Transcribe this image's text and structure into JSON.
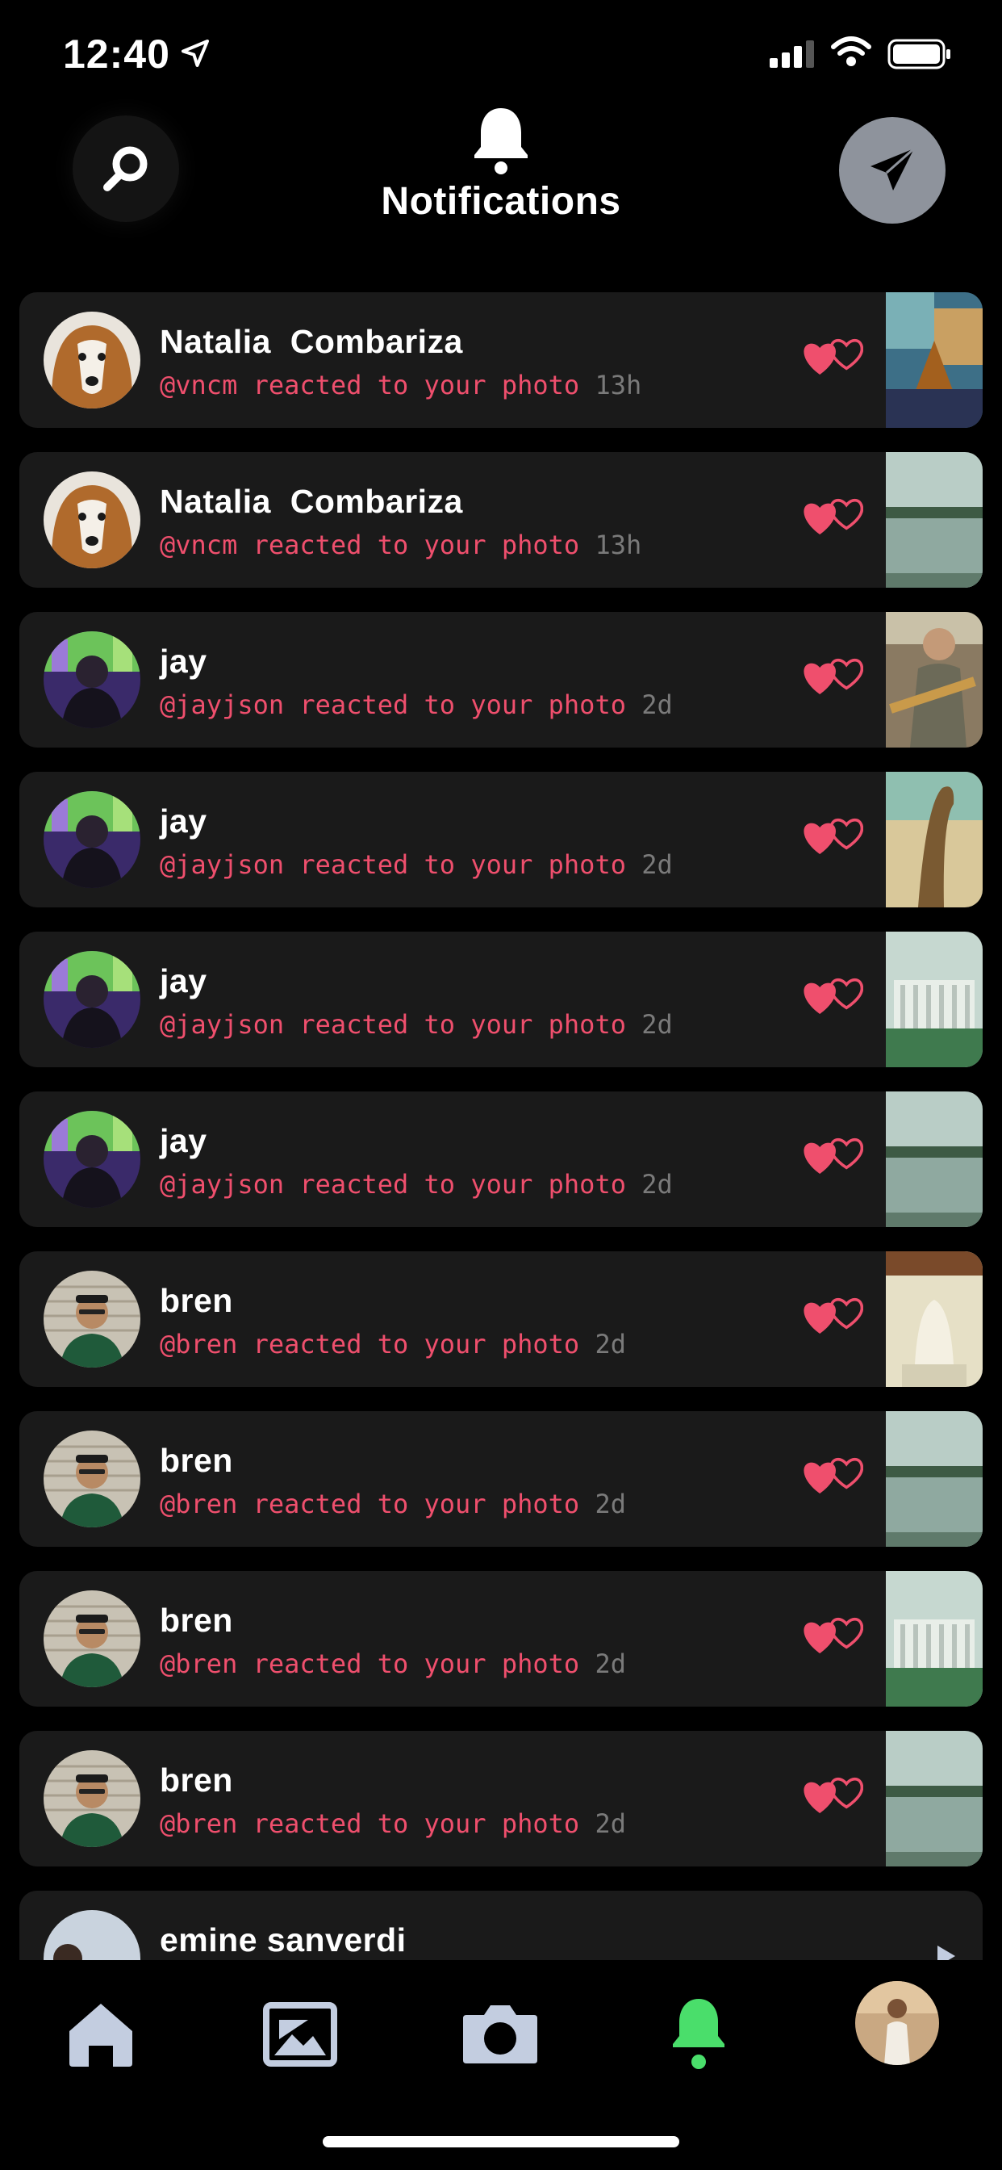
{
  "status": {
    "time": "12:40"
  },
  "header": {
    "title": "Notifications"
  },
  "notifications": [
    {
      "name": "Natalia  Combariza",
      "handle": "@vncm",
      "action": "reacted to your photo",
      "time": "13h",
      "avatar": "dog",
      "thumb": "room"
    },
    {
      "name": "Natalia  Combariza",
      "handle": "@vncm",
      "action": "reacted to your photo",
      "time": "13h",
      "avatar": "dog",
      "thumb": "lake"
    },
    {
      "name": "jay",
      "handle": "@jayjson",
      "action": "reacted to your photo",
      "time": "2d",
      "avatar": "jay",
      "thumb": "guitar"
    },
    {
      "name": "jay",
      "handle": "@jayjson",
      "action": "reacted to your photo",
      "time": "2d",
      "avatar": "jay",
      "thumb": "statue"
    },
    {
      "name": "jay",
      "handle": "@jayjson",
      "action": "reacted to your photo",
      "time": "2d",
      "avatar": "jay",
      "thumb": "memorial"
    },
    {
      "name": "jay",
      "handle": "@jayjson",
      "action": "reacted to your photo",
      "time": "2d",
      "avatar": "jay",
      "thumb": "lake"
    },
    {
      "name": "bren",
      "handle": "@bren",
      "action": "reacted to your photo",
      "time": "2d",
      "avatar": "bren",
      "thumb": "lincoln"
    },
    {
      "name": "bren",
      "handle": "@bren",
      "action": "reacted to your photo",
      "time": "2d",
      "avatar": "bren",
      "thumb": "lake"
    },
    {
      "name": "bren",
      "handle": "@bren",
      "action": "reacted to your photo",
      "time": "2d",
      "avatar": "bren",
      "thumb": "memorial"
    },
    {
      "name": "bren",
      "handle": "@bren",
      "action": "reacted to your photo",
      "time": "2d",
      "avatar": "bren",
      "thumb": "lake"
    },
    {
      "name": "emine sanverdi",
      "handle": "",
      "action": "",
      "time": "",
      "avatar": "emine",
      "thumb": ""
    }
  ],
  "tabs": [
    {
      "icon": "home-icon",
      "active": false
    },
    {
      "icon": "gallery-icon",
      "active": false
    },
    {
      "icon": "camera-icon",
      "active": false
    },
    {
      "icon": "bell-icon",
      "active": true
    },
    {
      "icon": "profile-avatar",
      "active": false
    }
  ],
  "colors": {
    "accent": "#ef4f6d",
    "active_tab": "#4ade6b",
    "inactive_tab": "#c3cde0",
    "card": "#1a1a1a",
    "muted": "#7a7a7a"
  }
}
